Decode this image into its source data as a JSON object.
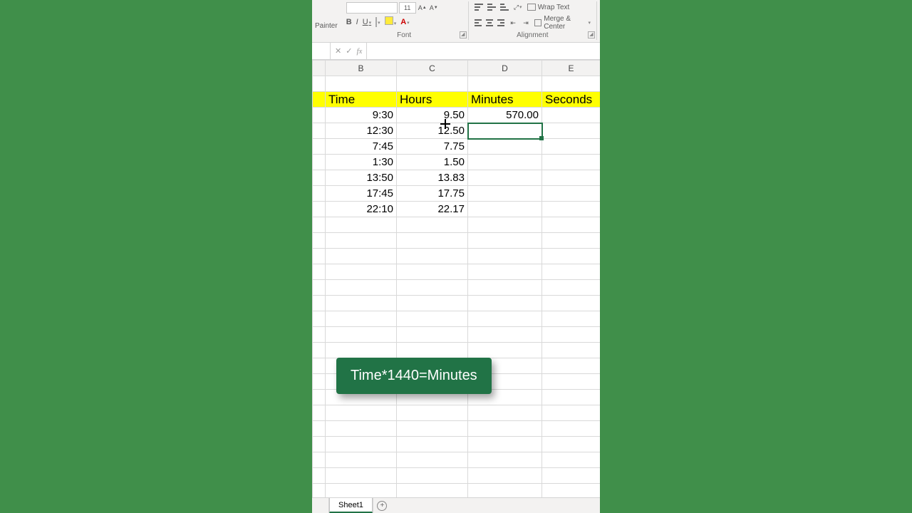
{
  "ribbon": {
    "painter": "Painter",
    "font_size": "11",
    "bold": "B",
    "italic": "I",
    "underline": "U",
    "font_group": "Font",
    "wrap_text": "Wrap Text",
    "merge_center": "Merge & Center",
    "alignment_group": "Alignment"
  },
  "formula_bar": {
    "cancel": "✕",
    "confirm": "✓",
    "fx": "fx",
    "value": ""
  },
  "columns": [
    "B",
    "C",
    "D",
    "E"
  ],
  "active_column_index": 2,
  "headers": [
    "Time",
    "Hours",
    "Minutes",
    "Seconds"
  ],
  "rows": [
    {
      "time": "9:30",
      "hours": "9.50",
      "minutes": "570.00",
      "seconds": ""
    },
    {
      "time": "12:30",
      "hours": "12.50",
      "minutes": "",
      "seconds": ""
    },
    {
      "time": "7:45",
      "hours": "7.75",
      "minutes": "",
      "seconds": ""
    },
    {
      "time": "1:30",
      "hours": "1.50",
      "minutes": "",
      "seconds": ""
    },
    {
      "time": "13:50",
      "hours": "13.83",
      "minutes": "",
      "seconds": ""
    },
    {
      "time": "17:45",
      "hours": "17.75",
      "minutes": "",
      "seconds": ""
    },
    {
      "time": "22:10",
      "hours": "22.17",
      "minutes": "",
      "seconds": ""
    }
  ],
  "callout": "Time*1440=Minutes",
  "sheet_tab": "Sheet1",
  "new_tab": "+"
}
